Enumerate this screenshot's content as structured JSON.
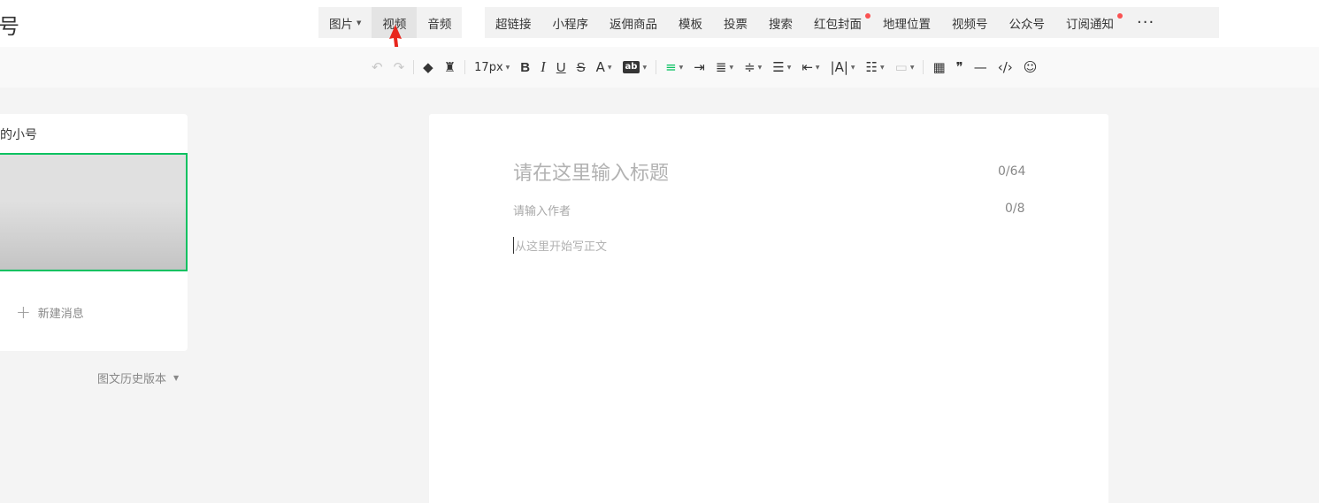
{
  "brand": {
    "title": "号"
  },
  "media_tabs": [
    {
      "label": "图片",
      "has_dropdown": true
    },
    {
      "label": "视频",
      "active": true
    },
    {
      "label": "音频"
    }
  ],
  "insert_tabs": [
    {
      "label": "超链接"
    },
    {
      "label": "小程序"
    },
    {
      "label": "返佣商品"
    },
    {
      "label": "模板"
    },
    {
      "label": "投票"
    },
    {
      "label": "搜索"
    },
    {
      "label": "红包封面",
      "badge": true
    },
    {
      "label": "地理位置"
    },
    {
      "label": "视频号"
    },
    {
      "label": "公众号"
    },
    {
      "label": "订阅通知",
      "badge": true
    }
  ],
  "more_label": "···",
  "toolbar": {
    "undo": "↶",
    "redo": "↷",
    "clear_format": "◆",
    "format_painter": "♜",
    "font_size": "17px",
    "bold": "B",
    "italic": "I",
    "underline": "U",
    "strike": "S",
    "font_color": "A",
    "bg_color": "ab",
    "align": "≡",
    "indent": "⇥",
    "outdent": "≣",
    "line_height": "≑",
    "paragraph_spacing": "☰",
    "text_indent": "⇤",
    "letter_spacing": "|A|",
    "list": "☷",
    "disabled_tool": "▭",
    "table": "▦",
    "quote": "❞",
    "divider": "—",
    "code": "‹/›",
    "emoji": "☺"
  },
  "sidebar": {
    "account_name": "的小号",
    "new_message": "新建消息",
    "history": "图文历史版本"
  },
  "editor": {
    "title_placeholder": "请在这里输入标题",
    "title_count": "0/64",
    "author_placeholder": "请输入作者",
    "author_count": "0/8",
    "body_placeholder": "从这里开始写正文"
  },
  "colors": {
    "accent": "#07c160",
    "badge": "#fa5151",
    "arrow": "#e8261c"
  }
}
